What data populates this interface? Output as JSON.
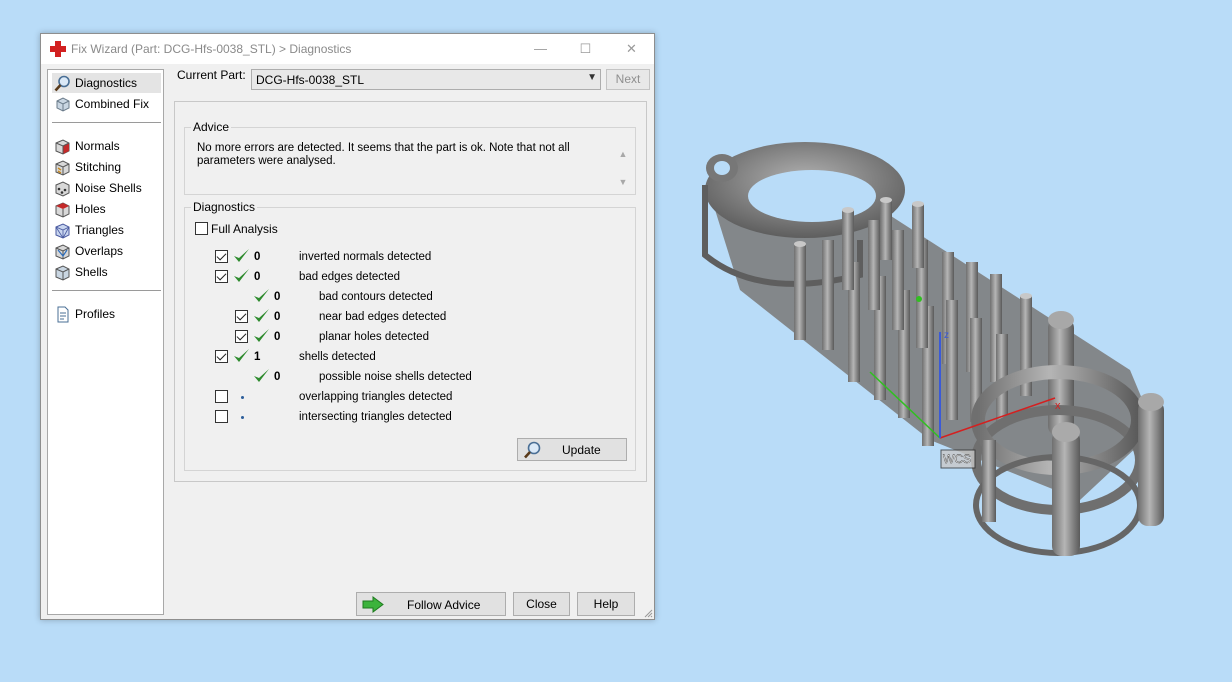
{
  "window": {
    "title": "Fix Wizard (Part: DCG-Hfs-0038_STL) > Diagnostics",
    "minimize": "—",
    "maximize": "☐",
    "close": "✕"
  },
  "sidebar": {
    "items": [
      {
        "label": "Diagnostics",
        "icon": "magnifier-icon"
      },
      {
        "label": "Combined Fix",
        "icon": "combined-fix-icon"
      },
      {
        "label": "Normals",
        "icon": "normals-cube-icon"
      },
      {
        "label": "Stitching",
        "icon": "stitching-cube-icon"
      },
      {
        "label": "Noise Shells",
        "icon": "noise-shells-icon"
      },
      {
        "label": "Holes",
        "icon": "holes-cube-icon"
      },
      {
        "label": "Triangles",
        "icon": "triangles-cube-icon"
      },
      {
        "label": "Overlaps",
        "icon": "overlaps-cube-icon"
      },
      {
        "label": "Shells",
        "icon": "shells-cube-icon"
      },
      {
        "label": "Profiles",
        "icon": "profile-document-icon"
      }
    ]
  },
  "header": {
    "current_part_label": "Current Part:",
    "current_part_value": "DCG-Hfs-0038_STL",
    "next_label": "Next"
  },
  "advice": {
    "title": "Advice",
    "text": "No more errors are detected. It seems that the part is ok. Note that not all parameters were analysed."
  },
  "diagnostics": {
    "title": "Diagnostics",
    "full_analysis_label": "Full Analysis",
    "rows": [
      {
        "checked": true,
        "status": "ok",
        "count": "0",
        "label": "inverted normals detected"
      },
      {
        "checked": true,
        "status": "ok",
        "count": "0",
        "label": "bad edges detected"
      },
      {
        "checked": null,
        "status": "ok",
        "count": "0",
        "label": "bad contours detected"
      },
      {
        "checked": true,
        "status": "ok",
        "count": "0",
        "label": "near bad edges detected"
      },
      {
        "checked": true,
        "status": "ok",
        "count": "0",
        "label": "planar holes detected"
      },
      {
        "checked": true,
        "status": "ok",
        "count": "1",
        "label": "shells detected"
      },
      {
        "checked": null,
        "status": "ok",
        "count": "0",
        "label": "possible noise shells detected"
      },
      {
        "checked": false,
        "status": "none",
        "count": "",
        "label": "overlapping triangles detected"
      },
      {
        "checked": false,
        "status": "none",
        "count": "",
        "label": "intersecting triangles detected"
      }
    ],
    "update_label": "Update"
  },
  "footer": {
    "follow_advice_label": "Follow Advice",
    "close_label": "Close",
    "help_label": "Help"
  },
  "viewport": {
    "axis_x": "x",
    "axis_z": "z",
    "wcs_label": "WCS"
  },
  "colors": {
    "check_green": "#2e8b2e",
    "model_gray": "#8a8a8a",
    "axis_x": "#d42020",
    "axis_y": "#30c020",
    "axis_z": "#3a5ad8",
    "background": "#b9dcf8"
  }
}
